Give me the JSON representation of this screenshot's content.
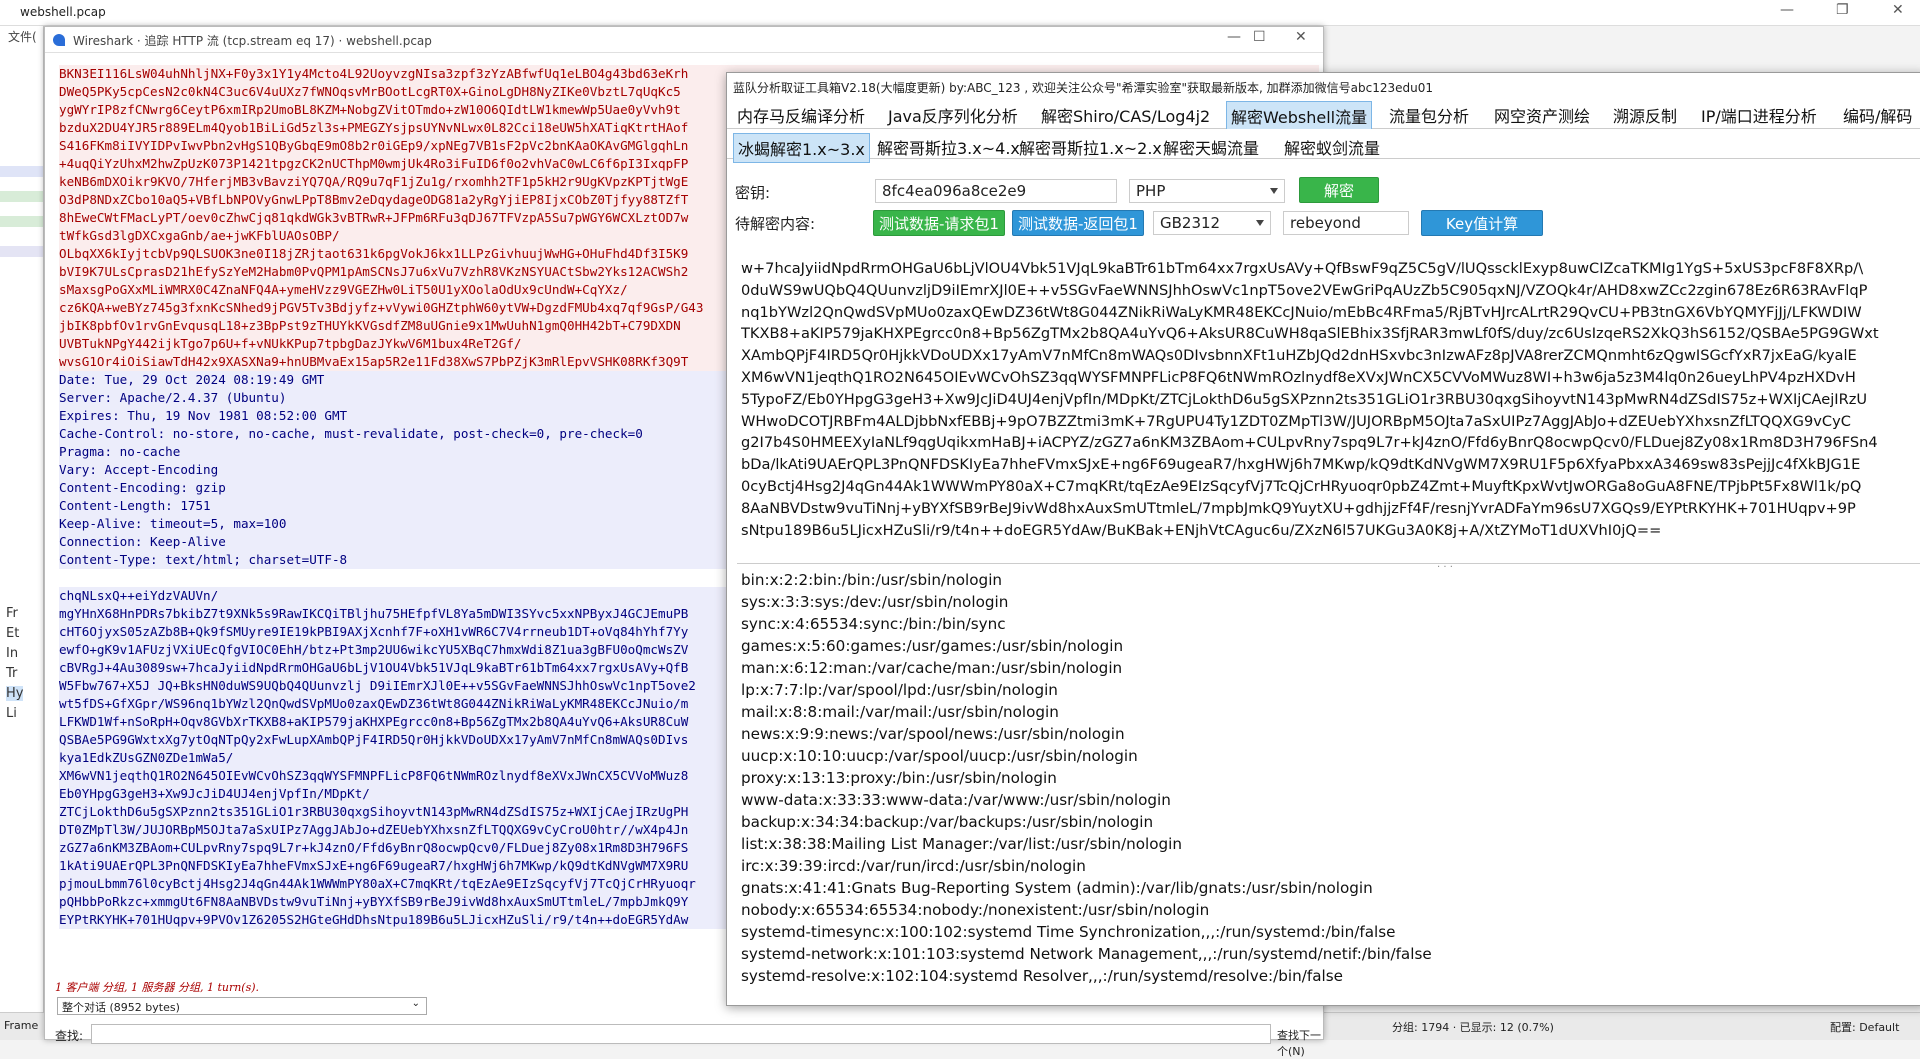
{
  "bg_window": {
    "title": "webshell.pcap",
    "menu_fragment": "文件(",
    "tree_items": [
      "Fr",
      "Et",
      "In",
      "Tr",
      "Hy",
      "Li"
    ],
    "status_left": "Frame",
    "packets_info": "分组: 1794 · 已显示: 12 (0.7%)",
    "profile": "配置: Default"
  },
  "follow_window": {
    "title": "Wireshark · 追踪 HTTP 流 (tcp.stream eq 17) · webshell.pcap",
    "request_lines": [
      "BKN3EI116LsW04uhNhljNX+F0y3x1Y1y4Mcto4L92UoyvzgNIsa3zpf3zYzABfwfUq1eLBO4g43bd63eKrh",
      "DWeQ5PKy5cpCesN2c0kN4C3uc6V4uUXz7fWNOqsvMrBOotLcgRT0X+GinoLgDH8NyZIKe0VbztL7qUqKc5",
      "ygWYrIP8zfCNwrg6CeytP6xmIRp2UmoBL8KZM+NobgZVitOTmdo+zW10O6QIdtLW1kmewWp5Uae0yVvh9t",
      "bzduX2DU4YJR5r889ELm4Qyob1BiLiGd5zl3s+PMEGZYsjpsUYNvNLwx0L82Cci18eUW5hXATiqKtrtHAof",
      "S416FKm8iIVYIDPvIwvPbn2vHgS1QByGbqE9mO8b2r0iGEp9/xpNEg7VB1sF2pVc2bnKAaOKAvGMGlgqhLn",
      "+4uqQiYzUhxM2hwZpUzK073P1421tpgzCK2nUCThpM0wmjUk4Ro3iFuID6f0o2vhVaC0wLC6f6pI3IxqpFP",
      "keNB6mDXOikr9KVO/7HferjMB3vBavziYQ7QA/RQ9u7qF1jZu1g/rxomhh2TF1p5kH2r9UgKVpzKPTjtWgE",
      "O3dP8NDxZCbo10aQ5+VBfLbNPOVyGnwLPpT8Bmv2eDqydageODG81a2yRgYjiEP8IjxCObZ0Tjfyy88TZfT",
      "8hEweCWtFMacLyPT/oev0cZhwCjq81qkdWGk3vBTRwR+JFPm6RFu3qDJ67TFVzpA5Su7pWGY6WCXLztOD7w",
      "tWfkGsd3lgDXCxgaGnb/ae+jwKFblUAOsOBP/",
      "OLbqXX6kIyjtcbVp9QLSUOK3ne0I18jZRjtaot631k6pgVokJ6kx1LLPzGivhuujWwHG+OHuFhd4Df3I5K9",
      "bVI9K7ULsCprasD21hEfySzYeM2Habm0PvQPM1pAmSCNsJ7u6xVu7VzhR8VKzNSYUACtSbw2Yks12ACWSh2",
      "sMaxsgPoGXxMLiWMRX0C4ZnaNFQ4A+ymeHVzz9VGEZHw0LiT50U1yXOolaOdUx9cUndW+CqYXz/",
      "cz6KQA+weBYz745g3fxnKcSNhed9jPGV5Tv3Bdjyfz+vVywi0GHZtphW60ytVW+DgzdFMUb4xq7qf9GsP/G43",
      "jbIK8pbfOv1rvGnEvqusqL18+z3BpPst9zTHUYkKVGsdfZM8uUGnie9x1MwUuhN1gmQ0HH42bT+C79DXDN",
      "UVBTukNPgY442ijkTgo7p6U+f+vNUkKPup7tpbgDazJYkwV6M1bux4ReT2Gf/",
      "wvsG1Or4iOiSiawTdH42x9XASXNa9+hnUBMvaEx15ap5R2e11Fd38XwS7PbPZjK3mRlEpvVSHK08RKf3Q9T"
    ],
    "response_headers": [
      "Date: Tue, 29 Oct 2024 08:19:49 GMT",
      "Server: Apache/2.4.37 (Ubuntu)",
      "Expires: Thu, 19 Nov 1981 08:52:00 GMT",
      "Cache-Control: no-store, no-cache, must-revalidate, post-check=0, pre-check=0",
      "Pragma: no-cache",
      "Vary: Accept-Encoding",
      "Content-Encoding: gzip",
      "Content-Length: 1751",
      "Keep-Alive: timeout=5, max=100",
      "Connection: Keep-Alive",
      "Content-Type: text/html; charset=UTF-8"
    ],
    "response_body": [
      "chqNLsxQ++eiYdzVAUVn/",
      "mgYHnX68HnPDRs7bkibZ7t9XNk5s9RawIKCQiTBljhu75HEfpfVL8Ya5mDWI3SYvc5xxNPByxJ4GCJEmuPB",
      "cHT6OjyxS05zAZb8B+Qk9fSMUyre9IE19kPBI9AXjXcnhf7F+oXH1vWR6C7V4rrneub1DT+oVq84hYhf7Yy",
      "ewfO+gK9v1AFUzjVXiUEcQfgVIOC0EhH/btz+Pt3mp2UU6wikcYU5XBqC7hmxWdi8Z1ua3gBFU0oQmcWsZV",
      "cBVRgJ+4Au3089sw+7hcaJyiidNpdRrmOHGaU6bLjV1OU4Vbk51VJqL9kaBTr61bTm64xx7rgxUsAVy+QfB",
      "W5Fbw767+X5J JQ+BksHN0duWS9UQbQ4QUunvzlj D9iIEmrXJl0E++v5SGvFaeWNNSJhhOswVc1npT5ove2",
      "wt5fDS+GfXGpr/WS96nq1bYWzl2QnQwdSVpMUo0zaxQEwDZ36tWt8G044ZNikRiWaLyKMR48EKCcJNuio/m",
      "LFKWD1Wf+nSoRpH+Oqv8GVbXrTKXB8+aKIP579jaKHXPEgrcc0n8+Bp56ZgTMx2b8QA4uYvQ6+AksUR8CuW",
      "QSBAe5PG9GWxtxXg7ytOqNTpQy2xFwLupXAmbQPjF4IRD5Qr0HjkkVDoUDXx17yAmV7nMfCn8mWAQs0DIvs",
      "kya1EdkZUsGZN0ZDe1mWa5/",
      "XM6wVN1jeqthQ1RO2N645OIEvWCvOhSZ3qqWYSFMNPFLicP8FQ6tNWmROzlnydf8eXVxJWnCX5CVVoMWuz8",
      "Eb0YHpgG3geH3+Xw9JcJiD4UJ4enjVpfIn/MDpKt/",
      "ZTCjLokthD6u5gSXPznn2ts351GLiO1r3RBU30qxgSihoyvtN143pMwRN4dZSdIS75z+WXIjCAejIRzUgPH",
      "DT0ZMpTl3W/JUJORBpM5OJta7aSxUIPz7AggJAbJo+dZEUebYXhxsnZfLTQQXG9vCyCroU0htr//wX4p4Jn",
      "zGZ7a6nKM3ZBAom+CULpvRny7spq9L7r+kJ4znO/Ffd6yBnrQ8ocwpQcv0/FLDuej8Zy08x1Rm8D3H796FS",
      "1kAti9UAErQPL3PnQNFDSKIyEa7hheFVmxSJxE+ng6F69ugeaR7/hxgHWj6h7MKwp/kQ9dtKdNVgWM7X9RU",
      "pjmouLbmm76l0cyBctj4Hsg2J4qGn44Ak1WWWmPY80aX+C7mqKRt/tqEzAe9EIzSqcyfVj7TcQjCrHRyuoqr",
      "pQHbbPoRkzc+xmmgUt6FN8AaNBVDstw9vuTiNnj+yBYXfSB9rBeJ9ivWd8hxAuxSmUTtmleL/7mpbJmkQ9Y",
      "EYPtRKYHK+701HUqpv+9PVOv1Z6205S2HGteGHdDhsNtpu189B6u5LJicxHZuSli/r9/t4n++doEGR5YdAw"
    ],
    "footer_info": "1 客户端 分组, 1 服务器 分组, 1 turn(s).",
    "conversation_select": "整个对话 (8952 bytes)",
    "find_label": "查找:",
    "find_next": "查找下一个(N)"
  },
  "tool": {
    "title": "蓝队分析取证工具箱V2.18(大幅度更新) by:ABC_123 , 欢迎关注公众号\"希潭实验室\"获取最新版本, 加群添加微信号abc123edu01",
    "menu_tabs": [
      "内存马反编译分析",
      "Java反序列化分析",
      "解密Shiro/CAS/Log4j2",
      "解密Webshell流量",
      "流量包分析",
      "网空资产测绘",
      "溯源反制",
      "IP/端口进程分析",
      "编码/解码"
    ],
    "active_menu": "解密Webshell流量",
    "sub_tabs": [
      "冰蝎解密1.x~3.x",
      "解密哥斯拉3.x~4.x",
      "解密哥斯拉1.x~2.x",
      "解密天蝎流量",
      "解密蚁剑流量"
    ],
    "active_sub": "冰蝎解密1.x~3.x",
    "key_label": "密钥:",
    "key_value": "8fc4ea096a8ce2e9",
    "lang_select": "PHP",
    "decrypt_button": "解密",
    "pending_label": "待解密内容:",
    "test_req_button": "测试数据-请求包1",
    "test_resp_button": "测试数据-返回包1",
    "encoding_select": "GB2312",
    "password_value": "rebeyond",
    "key_calc_button": "Key值计算",
    "cipher_lines": [
      "w+7hcaJyiidNpdRrmOHGaU6bLjVlOU4Vbk51VJqL9kaBTr61bTm64xx7rgxUsAVy+QfBswF9qZ5C5gV/lUQsscklExyp8uwCIZcaTKMIg1YgS+5xUS3pcF8F8XRp/\\",
      "0duWS9wUQbQ4QUunvzljD9iIEmrXJl0E++v5SGvFaeWNNSJhhOswVc1npT5ove2VEwGriPqAUzZb5C905qxNJ/VZOQk4r/AHD8xwZCc2zgin678Ez6R63RAvFlqP",
      "nq1bYWzl2QnQwdSVpMUo0zaxQEwDZ36tWt8G044ZNikRiWaLyKMR48EKCcJNuio/mEbBc4RFma5/RjBTvHJrcALrtR29QvCU+PB3tnGX6VbYQMYFjJj/LFKWDIW",
      "TKXB8+aKIP579jaKHXPEgrcc0n8+Bp56ZgTMx2b8QA4uYvQ6+AksUR8CuWH8qaSlEBhix3SfjRAR3mwLf0fS/duy/zc6UsIzqeRS2XkQ3hS6152/QSBAe5PG9GWxt",
      "XAmbQPjF4IRD5Qr0HjkkVDoUDXx17yAmV7nMfCn8mWAQs0DIvsbnnXFt1uHZbJQd2dnHSxvbc3nIzwAFz8pJVA8rerZCMQnmht6zQgwISGcfYxR7jxEaG/kyalE",
      "XM6wVN1jeqthQ1RO2N645OIEvWCvOhSZ3qqWYSFMNPFLicP8FQ6tNWmROzlnydf8eXVxJWnCX5CVVoMWuz8WI+h3w6ja5z3M4lq0n26ueyLhPV4pzHXDvH",
      "5TypoFZ/Eb0YHpgG3geH3+Xw9JcJiD4UJ4enjVpfIn/MDpKt/ZTCjLokthD6u5gSXPznn2ts351GLiO1r3RBU30qxgSihoyvtN143pMwRN4dZSdIS75z+WXIjCAejIRzU",
      "WHwoDCOTJRBFm4ALDjbbNxfEBBj+9pO7BZZtmi3mK+7RgUPU4Ty1ZDT0ZMpTl3W/JUJORBpM5OJta7aSxUIPz7AggJAbJo+dZEUebYXhxsnZfLTQQXG9vCyC",
      "g2I7b4S0HMEEXyIaNLf9qgUqikxmHaBJ+iACPYZ/zGZ7a6nKM3ZBAom+CULpvRny7spq9L7r+kJ4znO/Ffd6yBnrQ8ocwpQcv0/FLDuej8Zy08x1Rm8D3H796FSn4",
      "bDa/lkAti9UAErQPL3PnQNFDSKIyEa7hheFVmxSJxE+ng6F69ugeaR7/hxgHWj6h7MKwp/kQ9dtKdNVgWM7X9RU1F5p6XfyaPbxxA3469sw83sPejjJc4fXkBJG1E",
      "0cyBctj4Hsg2J4qGn44Ak1WWWmPY80aX+C7mqKRt/tqEzAe9EIzSqcyfVj7TcQjCrHRyuoqr0pbZ4Zmt+MuyftKpxWvtJwORGa8oGuA8FNE/TPjbPt5Fx8Wl1k/pQ",
      "8AaNBVDstw9vuTiNnj+yBYXfSB9rBeJ9ivWd8hxAuxSmUTtmleL/7mpbJmkQ9YuytXU+gdhjjzFf4F/resnjYvrADFaYm96sU7XGQs9/EYPtRKYHK+701HUqpv+9P",
      "sNtpu189B6u5LJicxHZuSli/r9/t4n++doEGR5YdAw/BuKBak+ENjhVtCAguc6u/ZXzN6l57UKGu3A0K8j+A/XtZYMoT1dUXVhI0jQ=="
    ],
    "plain_lines": [
      "bin:x:2:2:bin:/bin:/usr/sbin/nologin",
      "sys:x:3:3:sys:/dev:/usr/sbin/nologin",
      "sync:x:4:65534:sync:/bin:/bin/sync",
      "games:x:5:60:games:/usr/games:/usr/sbin/nologin",
      "man:x:6:12:man:/var/cache/man:/usr/sbin/nologin",
      "lp:x:7:7:lp:/var/spool/lpd:/usr/sbin/nologin",
      "mail:x:8:8:mail:/var/mail:/usr/sbin/nologin",
      "news:x:9:9:news:/var/spool/news:/usr/sbin/nologin",
      "uucp:x:10:10:uucp:/var/spool/uucp:/usr/sbin/nologin",
      "proxy:x:13:13:proxy:/bin:/usr/sbin/nologin",
      "www-data:x:33:33:www-data:/var/www:/usr/sbin/nologin",
      "backup:x:34:34:backup:/var/backups:/usr/sbin/nologin",
      "list:x:38:38:Mailing List Manager:/var/list:/usr/sbin/nologin",
      "irc:x:39:39:ircd:/var/run/ircd:/usr/sbin/nologin",
      "gnats:x:41:41:Gnats Bug-Reporting System (admin):/var/lib/gnats:/usr/sbin/nologin",
      "nobody:x:65534:65534:nobody:/nonexistent:/usr/sbin/nologin",
      "systemd-timesync:x:100:102:systemd Time Synchronization,,,:/run/systemd:/bin/false",
      "systemd-network:x:101:103:systemd Network Management,,,:/run/systemd/netif:/bin/false",
      "systemd-resolve:x:102:104:systemd Resolver,,,:/run/systemd/resolve:/bin/false"
    ]
  }
}
